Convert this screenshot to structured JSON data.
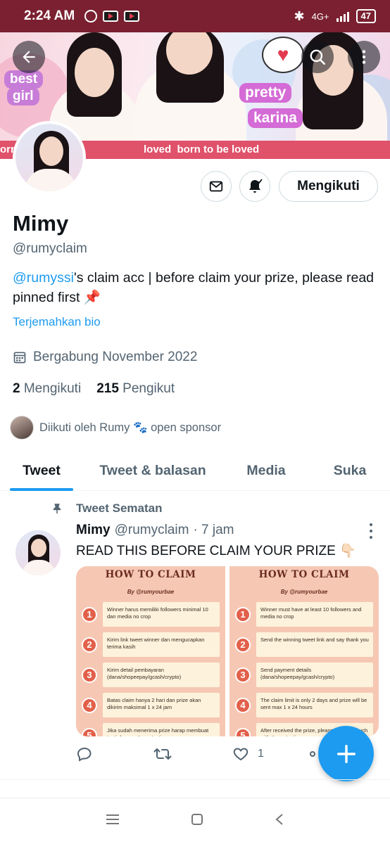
{
  "status_bar": {
    "time": "2:24 AM",
    "network": "4G+",
    "battery": "47"
  },
  "banner": {
    "tag_best": "best",
    "tag_girl": "girl",
    "tag_pretty": "pretty",
    "tag_karina": "karina",
    "strip_left": "orn",
    "strip_text": "loved  born to be loved"
  },
  "profile": {
    "name": "Mimy",
    "handle": "@rumyclaim",
    "bio_mention": "@rumyssi",
    "bio_text": "'s claim acc | before claim your prize, please read pinned first 📌",
    "translate_label": "Terjemahkan bio",
    "joined": "Bergabung November 2022",
    "following_count": "2",
    "following_label": "Mengikuti",
    "followers_count": "215",
    "followers_label": "Pengikut",
    "followed_by": "Diikuti oleh Rumy 🐾 open sponsor",
    "follow_button": "Mengikuti"
  },
  "tabs": [
    {
      "label": "Tweet"
    },
    {
      "label": "Tweet & balasan"
    },
    {
      "label": "Media"
    },
    {
      "label": "Suka"
    }
  ],
  "tweet": {
    "pinned_label": "Tweet Sematan",
    "author": "Mimy",
    "handle": "@rumyclaim",
    "time": "· 7 jam",
    "text": "READ THIS BEFORE CLAIM YOUR PRIZE 👇🏻",
    "like_count": "1",
    "cards": [
      {
        "title": "HOW TO CLAIM",
        "subtitle": "By @rumyourbae",
        "steps": [
          "Winner harus memiliki followers minimal 10 dan media no crop",
          "Kirim link tweet winner dan mengucapkan terima kasih",
          "Kirim detail pembayaran (dana/shopeepay/gcash/crypto)",
          "Batas claim hanya 2 hari dan prize akan dikirim maksimal 1 x 24 jam",
          "Jika sudah menerima prize harap membuat testi dengan #rumytesti"
        ]
      },
      {
        "title": "HOW TO CLAIM",
        "subtitle": "By @rumyourbae",
        "steps": [
          "Winner must have at least 10 followers and media no crop",
          "Send the winning tweet link and say thank you",
          "Send payment details (dana/shopeepay/gcash/crypto)",
          "The claim limit is only 2 days and prize will be sent max 1 x 24 hours",
          "After received the prize, please make a vouch with #rumytesti"
        ]
      }
    ]
  },
  "colors": {
    "status_bar": "#7a2030",
    "accent": "#1d9bf0",
    "secondary_text": "#536471"
  }
}
